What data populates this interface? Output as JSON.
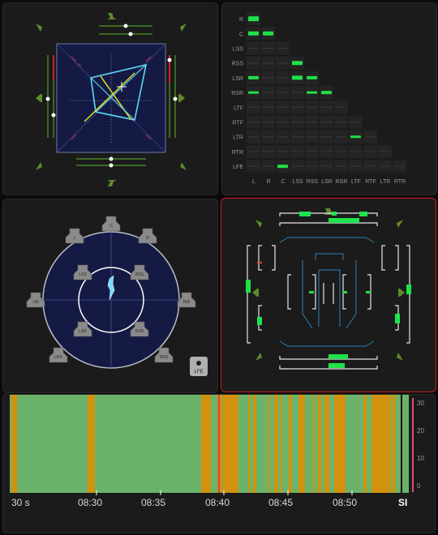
{
  "colors": {
    "background": "#0b0b0b",
    "panel": "#1b1b1b",
    "accent_green": "#1ee24a",
    "speaker_green": "#5d8a2c",
    "cyan": "#59d6f0",
    "yellow": "#e0e020",
    "red_border": "#c8202a",
    "loudness_green": "#6bb36b",
    "loudness_orange": "#d3920e",
    "loudness_red": "#e04040"
  },
  "matrix": {
    "row_labels": [
      "R",
      "C",
      "LSS",
      "RSS",
      "LSR",
      "RSR",
      "LTF",
      "RTF",
      "LTR",
      "RTR",
      "LFE"
    ],
    "col_labels": [
      "L",
      "R",
      "C",
      "LSS",
      "RSS",
      "LSR",
      "RSR",
      "LTF",
      "RTF",
      "LTR",
      "RTR"
    ]
  },
  "object_panner": {
    "speaker_labels": [
      "C",
      "L",
      "R",
      "LW",
      "RW",
      "LSS",
      "RSS",
      "LSR",
      "RSR",
      "LRS",
      "RRS"
    ],
    "lfe_label": "LFE"
  },
  "timeline": {
    "left_label": "30 s",
    "times": [
      "08:30",
      "08:35",
      "08:40",
      "08:45",
      "08:50"
    ],
    "unit_label": "SI",
    "scale": [
      "30",
      "20",
      "10",
      "0"
    ]
  }
}
